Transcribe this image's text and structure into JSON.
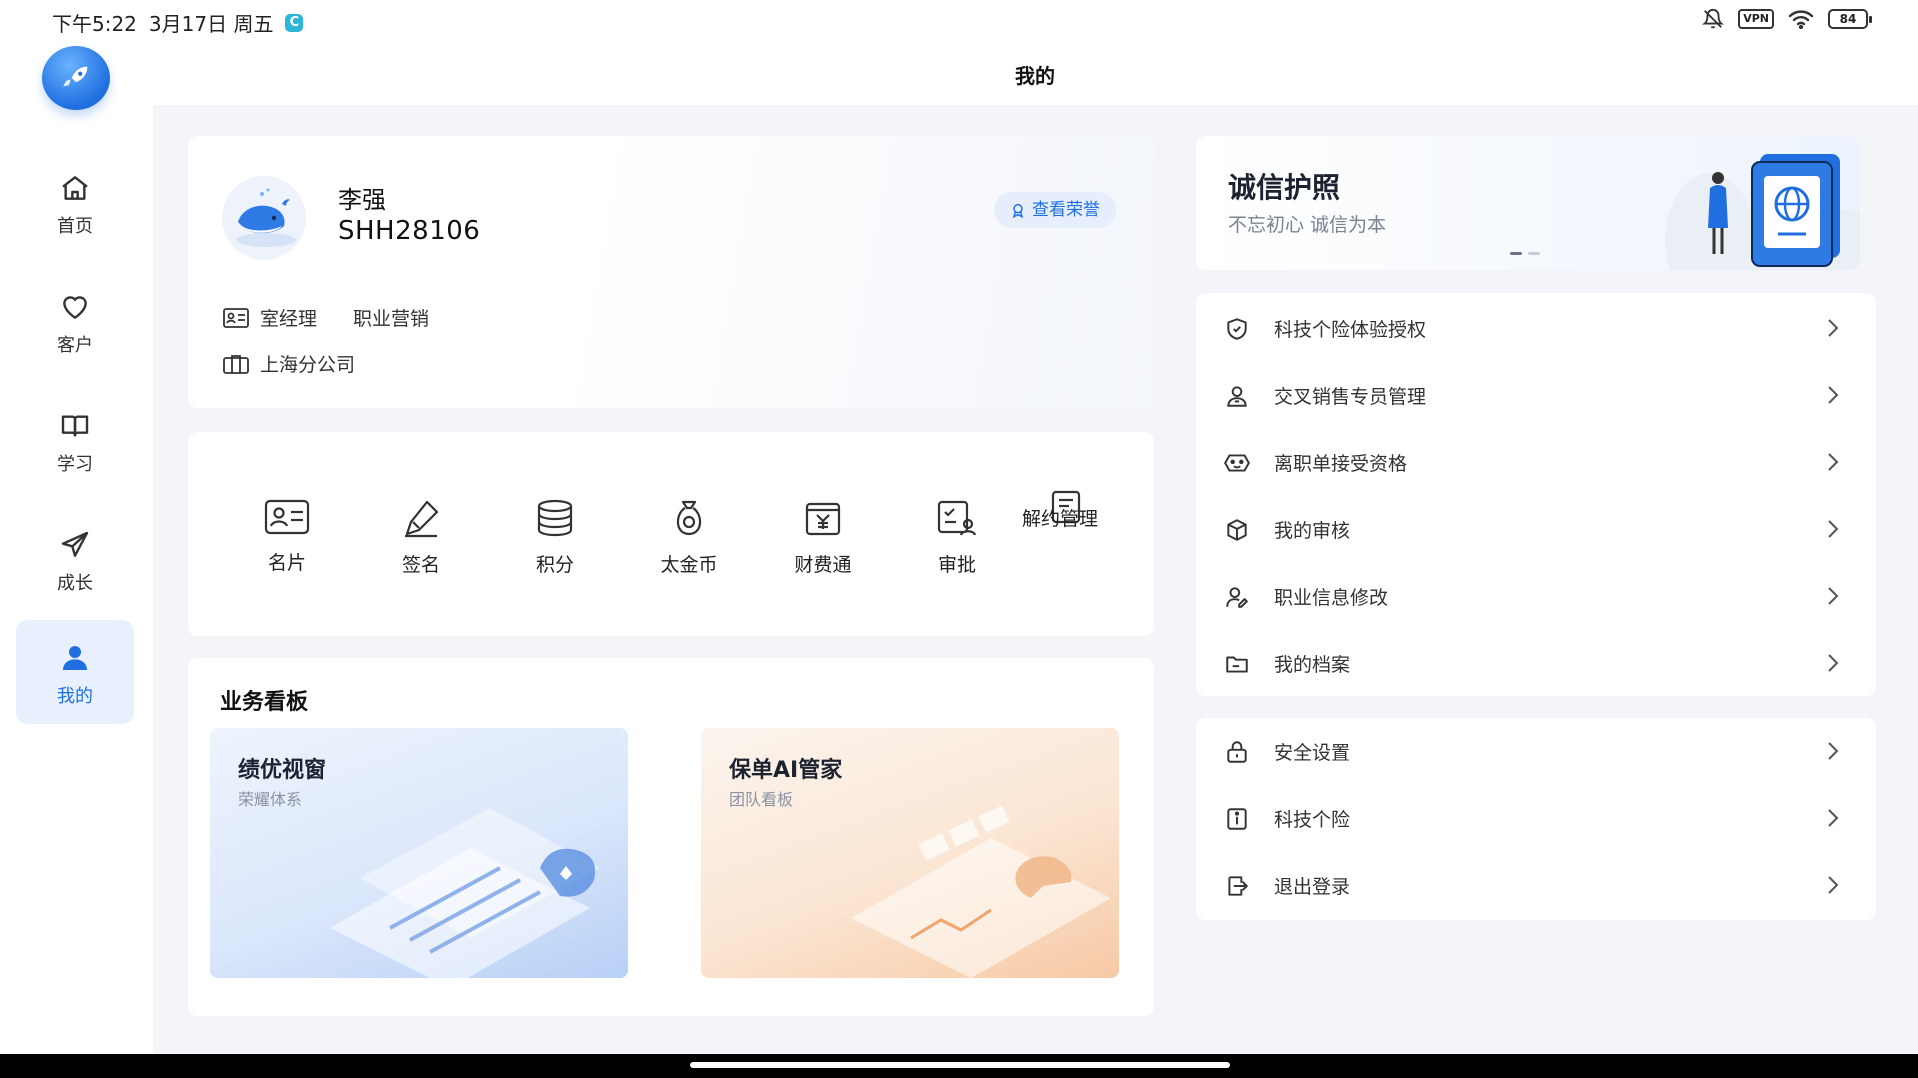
{
  "status_bar": {
    "time": "下午5:22",
    "date": "3月17日 周五",
    "vpn": "VPN",
    "battery": "84"
  },
  "header": {
    "title": "我的"
  },
  "sidebar": {
    "items": [
      {
        "label": "首页",
        "icon": "home-icon"
      },
      {
        "label": "客户",
        "icon": "heart-icon"
      },
      {
        "label": "学习",
        "icon": "book-icon"
      },
      {
        "label": "成长",
        "icon": "send-icon"
      },
      {
        "label": "我的",
        "icon": "person-icon",
        "active": true
      }
    ]
  },
  "profile": {
    "name": "李强",
    "id": "SHH28106",
    "honor_button": "查看荣誉",
    "position": "室经理",
    "channel": "职业营销",
    "branch": "上海分公司"
  },
  "tools": [
    {
      "label": "名片",
      "icon": "id-card-icon"
    },
    {
      "label": "签名",
      "icon": "pen-icon"
    },
    {
      "label": "积分",
      "icon": "coins-icon"
    },
    {
      "label": "太金币",
      "icon": "money-bag-icon"
    },
    {
      "label": "财费通",
      "icon": "yuan-box-icon"
    },
    {
      "label": "审批",
      "icon": "approval-icon"
    },
    {
      "label": "解约管理",
      "icon": "contract-icon"
    }
  ],
  "board": {
    "title": "业务看板",
    "panels": [
      {
        "title": "绩优视窗",
        "subtitle": "荣耀体系"
      },
      {
        "title": "保单AI管家",
        "subtitle": "团队看板"
      }
    ]
  },
  "banner": {
    "title": "诚信护照",
    "subtitle": "不忘初心 诚信为本"
  },
  "menu_group_1": [
    {
      "label": "科技个险体验授权",
      "icon": "shield-icon"
    },
    {
      "label": "交叉销售专员管理",
      "icon": "user-icon"
    },
    {
      "label": "离职单接受资格",
      "icon": "face-icon"
    },
    {
      "label": "我的审核",
      "icon": "cube-icon"
    },
    {
      "label": "职业信息修改",
      "icon": "user-edit-icon"
    },
    {
      "label": "我的档案",
      "icon": "folder-icon"
    }
  ],
  "menu_group_2": [
    {
      "label": "安全设置",
      "icon": "lock-icon"
    },
    {
      "label": "科技个险",
      "icon": "info-icon"
    },
    {
      "label": "退出登录",
      "icon": "logout-icon"
    }
  ],
  "colors": {
    "accent": "#1f6fe0",
    "background": "#f3f5f8",
    "card": "#ffffff"
  }
}
